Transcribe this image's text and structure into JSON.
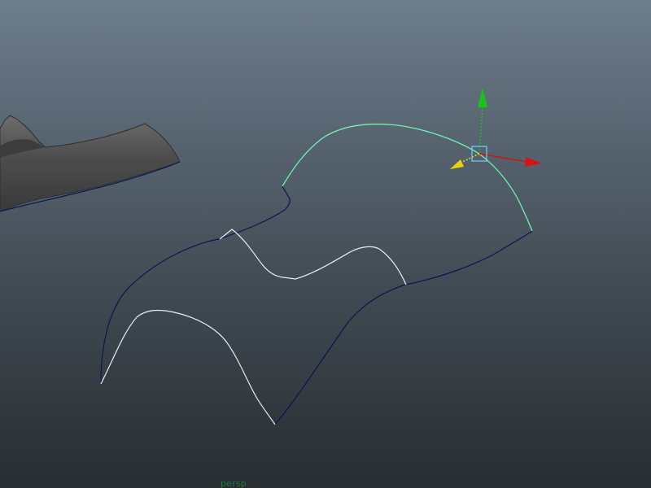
{
  "viewport": {
    "camera_name": "persp",
    "colors": {
      "background_top": "#6e7d8c",
      "background_bottom": "#282d32",
      "selected_curve": "#6ff0b4",
      "edge_curve": "#0e1550",
      "profile_curve": "#e6eef2",
      "mesh_surface": "#4c4c4c",
      "gizmo_x_axis": "#d61414",
      "gizmo_y_axis": "#19c419",
      "gizmo_z_axis": "#e8d20a",
      "gizmo_center": "#6fd0ff"
    },
    "objects": [
      {
        "name": "nurbs-surface-partial",
        "type": "mesh"
      },
      {
        "name": "selected-curve",
        "type": "nurbs-curve",
        "selected": true
      },
      {
        "name": "boundary-curve",
        "type": "nurbs-curve"
      },
      {
        "name": "upper-profile-curve",
        "type": "nurbs-curve"
      },
      {
        "name": "lower-profile-curve",
        "type": "nurbs-curve"
      }
    ],
    "manipulator": {
      "tool": "move",
      "axes": [
        "x",
        "y",
        "z"
      ]
    }
  }
}
